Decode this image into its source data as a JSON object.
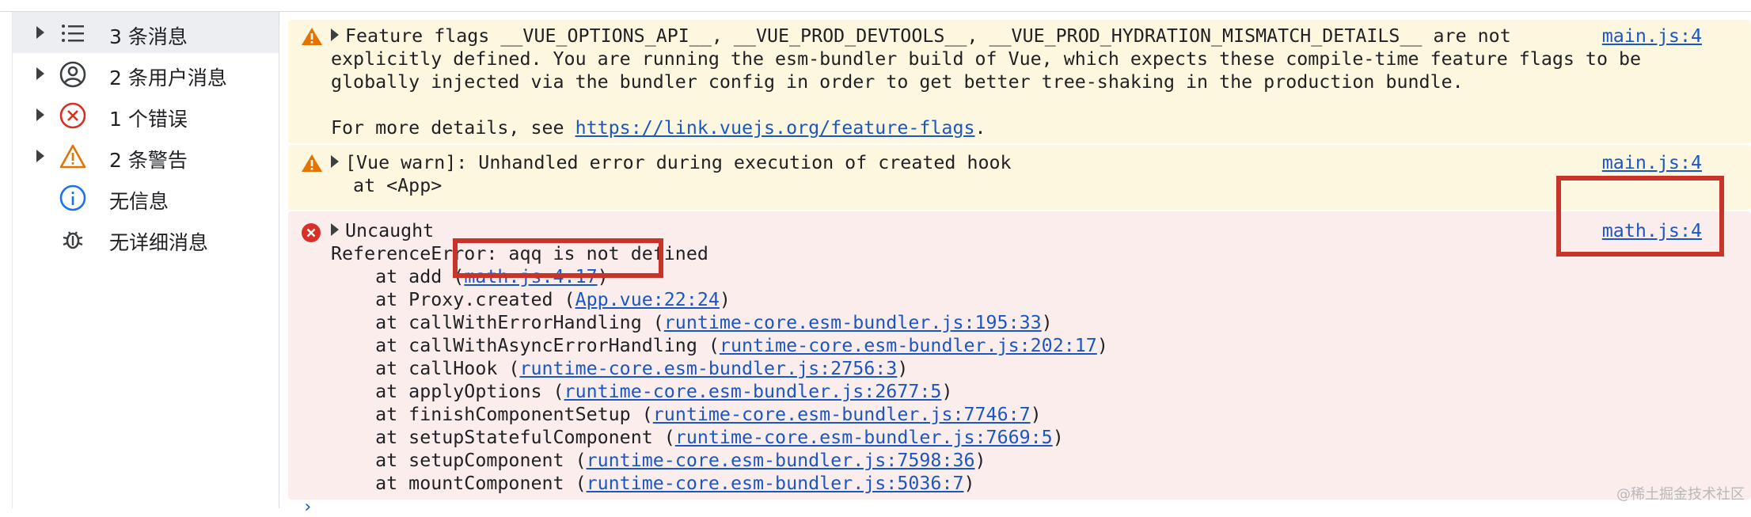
{
  "sidebar": {
    "items": [
      {
        "label": "3 条消息",
        "icon": "list-icon"
      },
      {
        "label": "2 条用户消息",
        "icon": "user-icon"
      },
      {
        "label": "1 个错误",
        "icon": "error-icon"
      },
      {
        "label": "2 条警告",
        "icon": "warning-icon"
      },
      {
        "label": "无信息",
        "icon": "info-icon"
      },
      {
        "label": "无详细消息",
        "icon": "bug-icon"
      }
    ]
  },
  "console": {
    "warning1": {
      "lines": [
        "Feature flags __VUE_OPTIONS_API__, __VUE_PROD_DEVTOOLS__, __VUE_PROD_HYDRATION_MISMATCH_DETAILS__ are not",
        "explicitly defined. You are running the esm-bundler build of Vue, which expects these compile-time feature flags to be",
        "globally injected via the bundler config in order to get better tree-shaking in the production bundle."
      ],
      "details_prefix": "For more details, see ",
      "details_link": "https://link.vuejs.org/feature-flags",
      "details_suffix": ".",
      "source": "main.js:4"
    },
    "warning2": {
      "line1": "[Vue warn]: Unhandled error during execution of created hook",
      "line2": "  at <App>",
      "source": "main.js:4"
    },
    "error": {
      "title": "Uncaught",
      "message": "ReferenceError: aqq is not defined",
      "source": "math.js:4",
      "stack": [
        {
          "fn": "    at add (",
          "loc": "math.js:4:17",
          "end": ")"
        },
        {
          "fn": "    at Proxy.created (",
          "loc": "App.vue:22:24",
          "end": ")"
        },
        {
          "fn": "    at callWithErrorHandling (",
          "loc": "runtime-core.esm-bundler.js:195:33",
          "end": ")"
        },
        {
          "fn": "    at callWithAsyncErrorHandling (",
          "loc": "runtime-core.esm-bundler.js:202:17",
          "end": ")"
        },
        {
          "fn": "    at callHook (",
          "loc": "runtime-core.esm-bundler.js:2756:3",
          "end": ")"
        },
        {
          "fn": "    at applyOptions (",
          "loc": "runtime-core.esm-bundler.js:2677:5",
          "end": ")"
        },
        {
          "fn": "    at finishComponentSetup (",
          "loc": "runtime-core.esm-bundler.js:7746:7",
          "end": ")"
        },
        {
          "fn": "    at setupStatefulComponent (",
          "loc": "runtime-core.esm-bundler.js:7669:5",
          "end": ")"
        },
        {
          "fn": "    at setupComponent (",
          "loc": "runtime-core.esm-bundler.js:7598:36",
          "end": ")"
        },
        {
          "fn": "    at mountComponent (",
          "loc": "runtime-core.esm-bundler.js:5036:7",
          "end": ")"
        }
      ]
    },
    "prompt": "›"
  },
  "watermark": "@稀土掘金技术社区",
  "colors": {
    "warning_bg": "#fef7e0",
    "error_bg": "#fceded",
    "link": "#1a57c5",
    "highlight": "#c8332a"
  }
}
